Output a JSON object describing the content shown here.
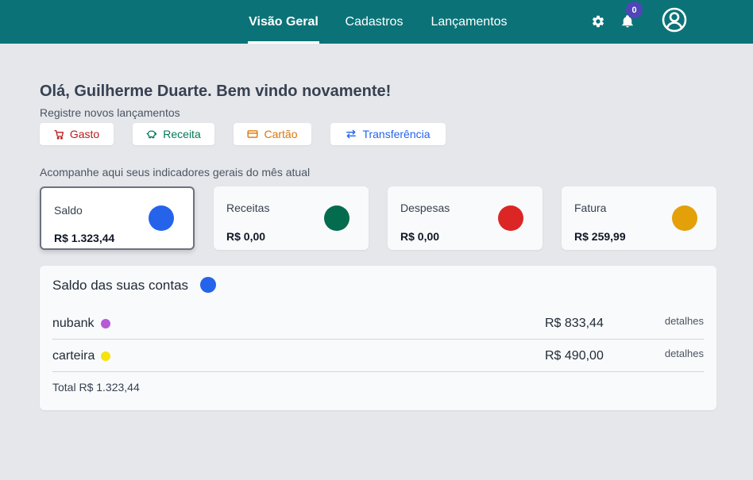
{
  "nav": {
    "tabs": [
      {
        "label": "Visão Geral",
        "active": true
      },
      {
        "label": "Cadastros",
        "active": false
      },
      {
        "label": "Lançamentos",
        "active": false
      }
    ],
    "icons": [
      "gear-icon",
      "bell-icon",
      "user-circle-icon"
    ],
    "notifications_count": "0"
  },
  "greeting": {
    "title": "Olá, Guilherme Duarte. Bem vindo novamente!",
    "subtitle": "Registre novos lançamentos"
  },
  "quick_actions": [
    {
      "label": "Gasto",
      "icon": "cart-icon",
      "color": "#b91c1c"
    },
    {
      "label": "Receita",
      "icon": "piggy-bank-icon",
      "color": "#047857"
    },
    {
      "label": "Cartão",
      "icon": "credit-card-icon",
      "color": "#d97706"
    },
    {
      "label": "Transferência",
      "icon": "transfer-arrows-icon",
      "color": "#2563eb"
    }
  ],
  "indicators": {
    "caption": "Acompanhe aqui seus indicadores gerais do mês atual",
    "cards": [
      {
        "label": "Saldo",
        "value": "R$ 1.323,44",
        "color": "#2563eb",
        "selected": true
      },
      {
        "label": "Receitas",
        "value": "R$ 0,00",
        "color": "#046c4e",
        "selected": false
      },
      {
        "label": "Despesas",
        "value": "R$ 0,00",
        "color": "#dc2626",
        "selected": false
      },
      {
        "label": "Fatura",
        "value": "R$ 259,99",
        "color": "#e3a008",
        "selected": false
      }
    ]
  },
  "accounts": {
    "title": "Saldo das suas contas",
    "title_color": "#2563eb",
    "rows": [
      {
        "name": "nubank",
        "dot_color": "#b65ad6",
        "amount": "R$ 833,44",
        "link": "detalhes"
      },
      {
        "name": "carteira",
        "dot_color": "#f5e30b",
        "amount": "R$ 490,00",
        "link": "detalhes"
      }
    ],
    "total": "Total R$ 1.323,44"
  },
  "colors": {
    "topbar": "#0b7377",
    "background": "#e5e7eb",
    "badge": "#4f46b8"
  }
}
